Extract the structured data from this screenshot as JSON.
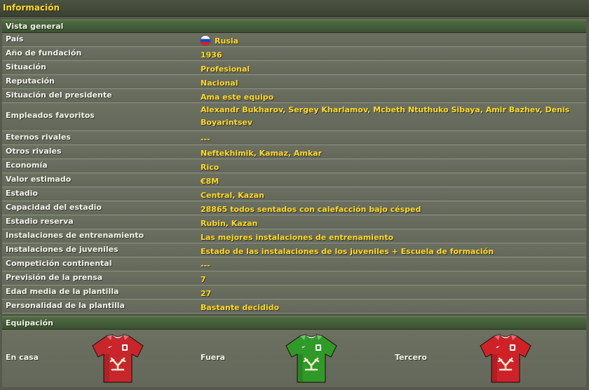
{
  "panel": {
    "title": "Información"
  },
  "overview": {
    "header": "Vista general",
    "rows": [
      {
        "label": "País",
        "value": "Rusia"
      },
      {
        "label": "Año de fundación",
        "value": "1936"
      },
      {
        "label": "Situación",
        "value": "Profesional"
      },
      {
        "label": "Reputación",
        "value": "Nacional"
      },
      {
        "label": "Situación del presidente",
        "value": "Ama este equipo"
      },
      {
        "label": "Empleados favoritos",
        "value": "Alexandr Bukharov, Sergey Kharlamov, Mcbeth Ntuthuko Sibaya, Amir Bazhev, Denis Boyarintsev"
      },
      {
        "label": "Eternos rivales",
        "value": "---"
      },
      {
        "label": "Otros rivales",
        "value": "Neftekhimik, Kamaz, Amkar"
      },
      {
        "label": "Economía",
        "value": "Rico"
      },
      {
        "label": "Valor estimado",
        "value": "€8M"
      },
      {
        "label": "Estadio",
        "value": "Central, Kazan"
      },
      {
        "label": "Capacidad del estadio",
        "value": "28865 todos sentados con calefacción bajo césped"
      },
      {
        "label": "Estadio reserva",
        "value": "Rubin, Kazan"
      },
      {
        "label": "Instalaciones de entrenamiento",
        "value": "Las mejores instalaciones de entrenamiento"
      },
      {
        "label": "Instalaciones de juveniles",
        "value": "Estado de las instalaciones de los juveniles + Escuela de formación"
      },
      {
        "label": "Competición continental",
        "value": "---"
      },
      {
        "label": "Previsión de la prensa",
        "value": "7"
      },
      {
        "label": "Edad media de la plantilla",
        "value": "27"
      },
      {
        "label": "Personalidad de la plantilla",
        "value": "Bastante decidido"
      }
    ]
  },
  "kits": {
    "header": "Equipación",
    "items": [
      {
        "label": "En casa",
        "color": "#c8262b",
        "icon": "home-kit-shirt-icon"
      },
      {
        "label": "Fuera",
        "color": "#2f9a28",
        "icon": "away-kit-shirt-icon"
      },
      {
        "label": "Tercero",
        "color": "#cf2228",
        "icon": "third-kit-shirt-icon"
      }
    ]
  },
  "icons": {
    "country_flag": "russia-flag-icon"
  }
}
